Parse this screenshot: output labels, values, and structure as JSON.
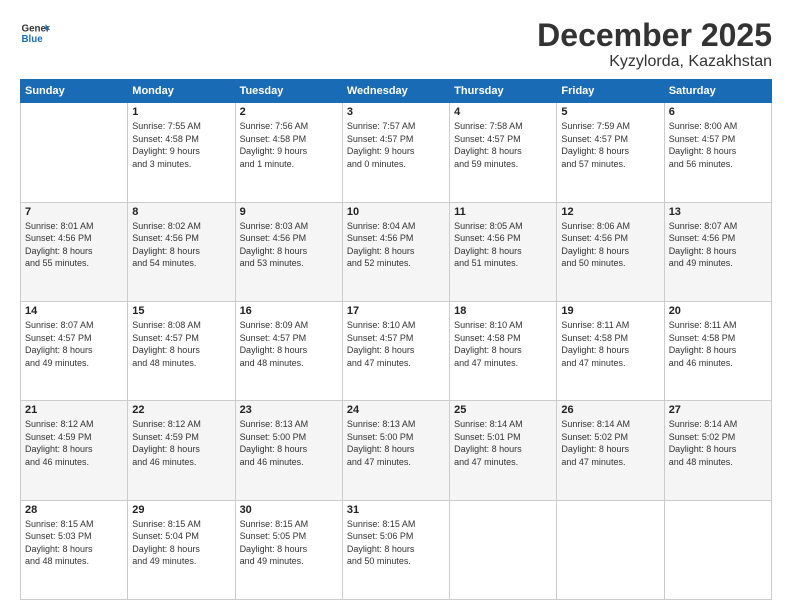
{
  "header": {
    "logo_line1": "General",
    "logo_line2": "Blue",
    "title": "December 2025",
    "subtitle": "Kyzylorda, Kazakhstan"
  },
  "days_of_week": [
    "Sunday",
    "Monday",
    "Tuesday",
    "Wednesday",
    "Thursday",
    "Friday",
    "Saturday"
  ],
  "weeks": [
    [
      {
        "day": "",
        "info": ""
      },
      {
        "day": "1",
        "info": "Sunrise: 7:55 AM\nSunset: 4:58 PM\nDaylight: 9 hours\nand 3 minutes."
      },
      {
        "day": "2",
        "info": "Sunrise: 7:56 AM\nSunset: 4:58 PM\nDaylight: 9 hours\nand 1 minute."
      },
      {
        "day": "3",
        "info": "Sunrise: 7:57 AM\nSunset: 4:57 PM\nDaylight: 9 hours\nand 0 minutes."
      },
      {
        "day": "4",
        "info": "Sunrise: 7:58 AM\nSunset: 4:57 PM\nDaylight: 8 hours\nand 59 minutes."
      },
      {
        "day": "5",
        "info": "Sunrise: 7:59 AM\nSunset: 4:57 PM\nDaylight: 8 hours\nand 57 minutes."
      },
      {
        "day": "6",
        "info": "Sunrise: 8:00 AM\nSunset: 4:57 PM\nDaylight: 8 hours\nand 56 minutes."
      }
    ],
    [
      {
        "day": "7",
        "info": "Sunrise: 8:01 AM\nSunset: 4:56 PM\nDaylight: 8 hours\nand 55 minutes."
      },
      {
        "day": "8",
        "info": "Sunrise: 8:02 AM\nSunset: 4:56 PM\nDaylight: 8 hours\nand 54 minutes."
      },
      {
        "day": "9",
        "info": "Sunrise: 8:03 AM\nSunset: 4:56 PM\nDaylight: 8 hours\nand 53 minutes."
      },
      {
        "day": "10",
        "info": "Sunrise: 8:04 AM\nSunset: 4:56 PM\nDaylight: 8 hours\nand 52 minutes."
      },
      {
        "day": "11",
        "info": "Sunrise: 8:05 AM\nSunset: 4:56 PM\nDaylight: 8 hours\nand 51 minutes."
      },
      {
        "day": "12",
        "info": "Sunrise: 8:06 AM\nSunset: 4:56 PM\nDaylight: 8 hours\nand 50 minutes."
      },
      {
        "day": "13",
        "info": "Sunrise: 8:07 AM\nSunset: 4:56 PM\nDaylight: 8 hours\nand 49 minutes."
      }
    ],
    [
      {
        "day": "14",
        "info": "Sunrise: 8:07 AM\nSunset: 4:57 PM\nDaylight: 8 hours\nand 49 minutes."
      },
      {
        "day": "15",
        "info": "Sunrise: 8:08 AM\nSunset: 4:57 PM\nDaylight: 8 hours\nand 48 minutes."
      },
      {
        "day": "16",
        "info": "Sunrise: 8:09 AM\nSunset: 4:57 PM\nDaylight: 8 hours\nand 48 minutes."
      },
      {
        "day": "17",
        "info": "Sunrise: 8:10 AM\nSunset: 4:57 PM\nDaylight: 8 hours\nand 47 minutes."
      },
      {
        "day": "18",
        "info": "Sunrise: 8:10 AM\nSunset: 4:58 PM\nDaylight: 8 hours\nand 47 minutes."
      },
      {
        "day": "19",
        "info": "Sunrise: 8:11 AM\nSunset: 4:58 PM\nDaylight: 8 hours\nand 47 minutes."
      },
      {
        "day": "20",
        "info": "Sunrise: 8:11 AM\nSunset: 4:58 PM\nDaylight: 8 hours\nand 46 minutes."
      }
    ],
    [
      {
        "day": "21",
        "info": "Sunrise: 8:12 AM\nSunset: 4:59 PM\nDaylight: 8 hours\nand 46 minutes."
      },
      {
        "day": "22",
        "info": "Sunrise: 8:12 AM\nSunset: 4:59 PM\nDaylight: 8 hours\nand 46 minutes."
      },
      {
        "day": "23",
        "info": "Sunrise: 8:13 AM\nSunset: 5:00 PM\nDaylight: 8 hours\nand 46 minutes."
      },
      {
        "day": "24",
        "info": "Sunrise: 8:13 AM\nSunset: 5:00 PM\nDaylight: 8 hours\nand 47 minutes."
      },
      {
        "day": "25",
        "info": "Sunrise: 8:14 AM\nSunset: 5:01 PM\nDaylight: 8 hours\nand 47 minutes."
      },
      {
        "day": "26",
        "info": "Sunrise: 8:14 AM\nSunset: 5:02 PM\nDaylight: 8 hours\nand 47 minutes."
      },
      {
        "day": "27",
        "info": "Sunrise: 8:14 AM\nSunset: 5:02 PM\nDaylight: 8 hours\nand 48 minutes."
      }
    ],
    [
      {
        "day": "28",
        "info": "Sunrise: 8:15 AM\nSunset: 5:03 PM\nDaylight: 8 hours\nand 48 minutes."
      },
      {
        "day": "29",
        "info": "Sunrise: 8:15 AM\nSunset: 5:04 PM\nDaylight: 8 hours\nand 49 minutes."
      },
      {
        "day": "30",
        "info": "Sunrise: 8:15 AM\nSunset: 5:05 PM\nDaylight: 8 hours\nand 49 minutes."
      },
      {
        "day": "31",
        "info": "Sunrise: 8:15 AM\nSunset: 5:06 PM\nDaylight: 8 hours\nand 50 minutes."
      },
      {
        "day": "",
        "info": ""
      },
      {
        "day": "",
        "info": ""
      },
      {
        "day": "",
        "info": ""
      }
    ]
  ]
}
